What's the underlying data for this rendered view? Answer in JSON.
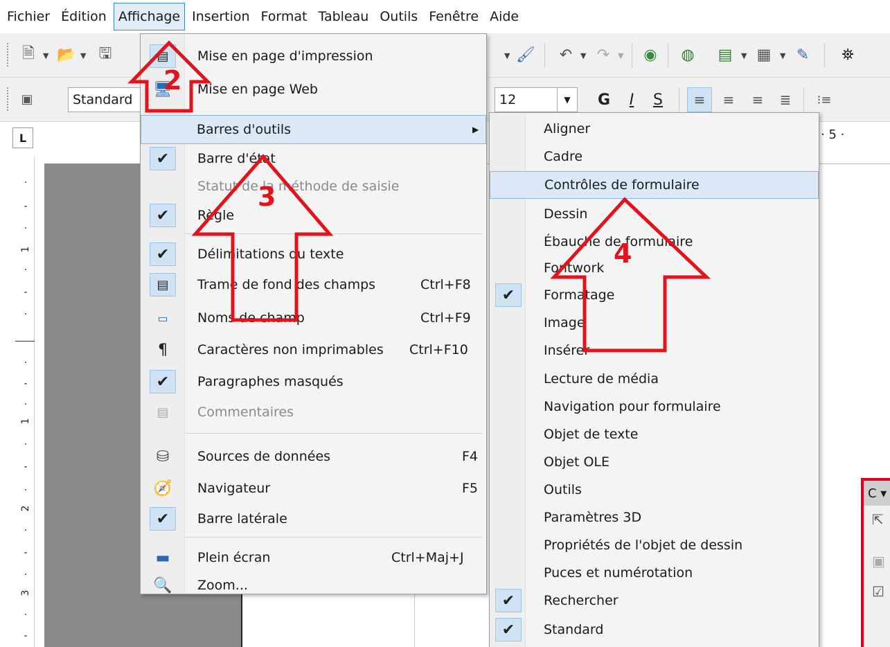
{
  "menubar": {
    "items": [
      {
        "label": "Fichier"
      },
      {
        "label": "Édition"
      },
      {
        "label": "Affichage"
      },
      {
        "label": "Insertion"
      },
      {
        "label": "Format"
      },
      {
        "label": "Tableau"
      },
      {
        "label": "Outils"
      },
      {
        "label": "Fenêtre"
      },
      {
        "label": "Aide"
      }
    ]
  },
  "toolbar2": {
    "style_value": "Standard",
    "size_value": "12",
    "bold": "G",
    "italic": "I",
    "underline": "S"
  },
  "ruler": {
    "h_label": "5",
    "v_labels": [
      "1",
      "1",
      "2",
      "3"
    ]
  },
  "view_menu": {
    "items": [
      {
        "label": "Mise en page d'impression",
        "shortcut": ""
      },
      {
        "label": "Mise en page Web",
        "shortcut": ""
      },
      {
        "label": "Barres d'outils",
        "shortcut": ""
      },
      {
        "label": "Barre d'état",
        "shortcut": ""
      },
      {
        "label": "Statut de la méthode de saisie",
        "shortcut": ""
      },
      {
        "label": "Règle",
        "shortcut": ""
      },
      {
        "label": "Délimitations du texte",
        "shortcut": ""
      },
      {
        "label": "Trame de fond des champs",
        "shortcut": "Ctrl+F8"
      },
      {
        "label": "Noms de champ",
        "shortcut": "Ctrl+F9"
      },
      {
        "label": "Caractères non imprimables",
        "shortcut": "Ctrl+F10"
      },
      {
        "label": "Paragraphes masqués",
        "shortcut": ""
      },
      {
        "label": "Commentaires",
        "shortcut": ""
      },
      {
        "label": "Sources de données",
        "shortcut": "F4"
      },
      {
        "label": "Navigateur",
        "shortcut": "F5"
      },
      {
        "label": "Barre latérale",
        "shortcut": ""
      },
      {
        "label": "Plein écran",
        "shortcut": "Ctrl+Maj+J"
      },
      {
        "label": "Zoom...",
        "shortcut": ""
      }
    ]
  },
  "toolbars_submenu": {
    "items": [
      {
        "label": "Aligner"
      },
      {
        "label": "Cadre"
      },
      {
        "label": "Contrôles de formulaire"
      },
      {
        "label": "Dessin"
      },
      {
        "label": "Ébauche de formulaire"
      },
      {
        "label": "Fontwork"
      },
      {
        "label": "Formatage"
      },
      {
        "label": "Image"
      },
      {
        "label": "Insérer"
      },
      {
        "label": "Lecture de média"
      },
      {
        "label": "Navigation pour formulaire"
      },
      {
        "label": "Objet de texte"
      },
      {
        "label": "Objet OLE"
      },
      {
        "label": "Outils"
      },
      {
        "label": "Paramètres 3D"
      },
      {
        "label": "Propriétés de l'objet de dessin"
      },
      {
        "label": "Puces et numérotation"
      },
      {
        "label": "Rechercher"
      },
      {
        "label": "Standard"
      }
    ]
  },
  "floating_toolbar": {
    "title": "C"
  },
  "annotations": [
    "2",
    "3",
    "4"
  ],
  "colors": {
    "annotation": "#e3131b",
    "highlight": "#dbe8f6",
    "check_bg": "#cfe3f5"
  }
}
